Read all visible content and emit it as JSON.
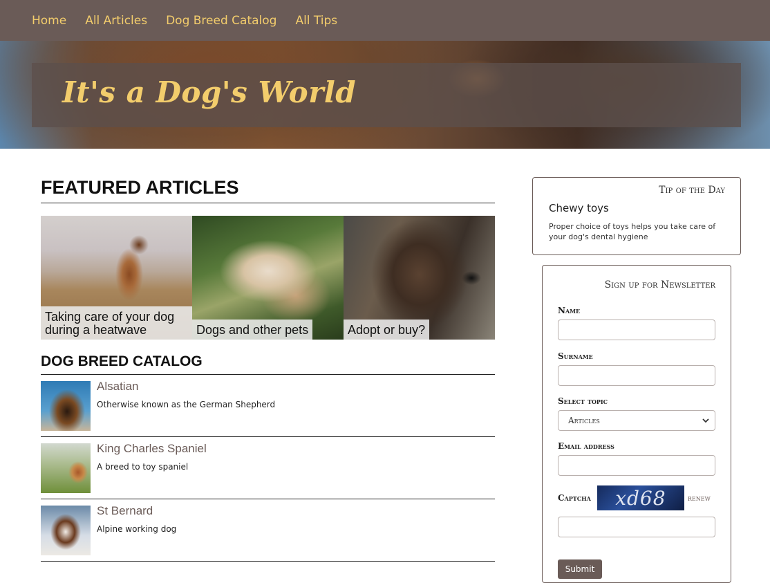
{
  "nav": {
    "items": [
      "Home",
      "All Articles",
      "Dog Breed Catalog",
      "All Tips"
    ]
  },
  "hero": {
    "title": "It's a Dog's World"
  },
  "featured": {
    "title": "FEATURED ARTICLES",
    "articles": [
      {
        "caption": "Taking care of your dog during a heatwave"
      },
      {
        "caption": "Dogs and other pets"
      },
      {
        "caption": "Adopt or buy?"
      }
    ]
  },
  "catalog": {
    "title": "DOG BREED CATALOG",
    "breeds": [
      {
        "name": "Alsatian",
        "description": "Otherwise known as the German Shepherd"
      },
      {
        "name": "King Charles Spaniel",
        "description": "A breed to toy spaniel"
      },
      {
        "name": "St Bernard",
        "description": "Alpine working dog"
      }
    ]
  },
  "tip": {
    "heading": "Tip of the Day",
    "title": "Chewy toys",
    "text": "Proper choice of toys helps you take care of your dog's dental hygiene"
  },
  "newsletter": {
    "heading": "Sign up for Newsletter",
    "name_label": "Name",
    "surname_label": "Surname",
    "topic_label": "Select topic",
    "topic_selected": "Articles",
    "email_label": "Email address",
    "captcha_label": "Captcha",
    "captcha_text": "xd68",
    "renew_label": "renew",
    "submit_label": "Submit"
  },
  "colors": {
    "nav_bg": "#6a5b57",
    "accent": "#f3cd6c"
  }
}
